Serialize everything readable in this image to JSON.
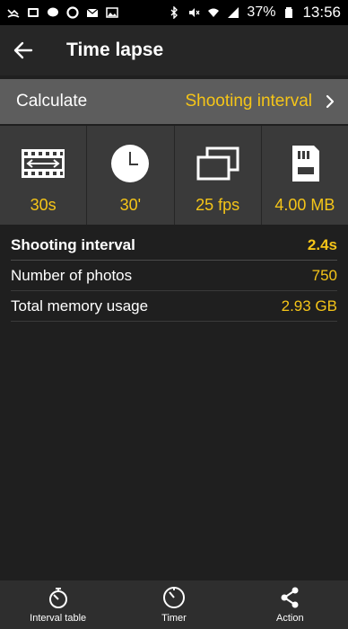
{
  "status_bar": {
    "battery": "37%",
    "time": "13:56"
  },
  "app_bar": {
    "title": "Time lapse"
  },
  "calculate": {
    "label": "Calculate",
    "value": "Shooting interval"
  },
  "params": [
    {
      "icon": "film-strip-icon",
      "value": "30s"
    },
    {
      "icon": "clock-icon",
      "value": "30'"
    },
    {
      "icon": "frames-icon",
      "value": "25 fps"
    },
    {
      "icon": "sd-card-icon",
      "value": "4.00 MB"
    }
  ],
  "results": [
    {
      "label": "Shooting interval",
      "value": "2.4s"
    },
    {
      "label": "Number of photos",
      "value": "750"
    },
    {
      "label": "Total memory usage",
      "value": "2.93 GB"
    }
  ],
  "bottom_nav": [
    {
      "icon": "stopwatch-icon",
      "label": "Interval table"
    },
    {
      "icon": "timer-icon",
      "label": "Timer"
    },
    {
      "icon": "share-icon",
      "label": "Action"
    }
  ],
  "colors": {
    "accent": "#f5c518",
    "background": "#1f1f1f",
    "app_bar": "#262626",
    "calc_row": "#5d5d5d",
    "params_row": "#3a3a3a"
  }
}
